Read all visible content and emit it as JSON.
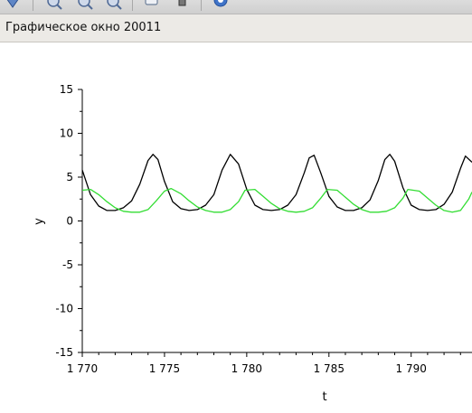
{
  "toolbar": {
    "buttons": [
      "pointer-icon",
      "zoom-in-icon",
      "zoom-out-icon",
      "rotate-icon",
      "datatip-icon",
      "edit-icon",
      "help-icon"
    ]
  },
  "window": {
    "title": "Графическое окно 20011"
  },
  "chart_data": {
    "type": "line",
    "title": "",
    "xlabel": "t",
    "ylabel": "y",
    "xlim": [
      1770,
      1793.7
    ],
    "ylim": [
      -15,
      15
    ],
    "x_ticks": [
      1770,
      1775,
      1780,
      1785,
      1790
    ],
    "x_tick_labels": [
      "1 770",
      "1 775",
      "1 780",
      "1 785",
      "1 790"
    ],
    "y_ticks": [
      15,
      10,
      5,
      0,
      -5,
      -10,
      -15
    ],
    "y_tick_labels": [
      "15",
      "10",
      "5",
      "0",
      "-5",
      "-10",
      "-15"
    ],
    "grid": false,
    "legend": "none",
    "series": [
      {
        "color": "#000000",
        "x": [
          1770.0,
          1770.5,
          1771.0,
          1771.5,
          1772.0,
          1772.5,
          1773.0,
          1773.5,
          1774.0,
          1774.3,
          1774.6,
          1775.0,
          1775.5,
          1776.0,
          1776.5,
          1777.0,
          1777.5,
          1778.0,
          1778.5,
          1779.0,
          1779.5,
          1780.0,
          1780.5,
          1781.0,
          1781.5,
          1782.0,
          1782.5,
          1783.0,
          1783.5,
          1783.8,
          1784.1,
          1784.5,
          1785.0,
          1785.5,
          1786.0,
          1786.5,
          1787.0,
          1787.5,
          1788.0,
          1788.4,
          1788.7,
          1789.0,
          1789.5,
          1790.0,
          1790.5,
          1791.0,
          1791.5,
          1792.0,
          1792.5,
          1793.0,
          1793.3,
          1793.7
        ],
        "y": [
          5.8,
          3.0,
          1.7,
          1.2,
          1.2,
          1.5,
          2.3,
          4.2,
          6.9,
          7.6,
          7.0,
          4.5,
          2.2,
          1.4,
          1.2,
          1.3,
          1.8,
          3.0,
          5.8,
          7.6,
          6.5,
          3.6,
          1.8,
          1.3,
          1.2,
          1.3,
          1.8,
          3.0,
          5.5,
          7.2,
          7.5,
          5.5,
          2.8,
          1.6,
          1.2,
          1.2,
          1.5,
          2.4,
          4.6,
          7.0,
          7.6,
          6.8,
          3.8,
          1.8,
          1.3,
          1.2,
          1.3,
          1.9,
          3.3,
          6.0,
          7.4,
          6.7
        ]
      },
      {
        "color": "#33dd33",
        "x": [
          1770.0,
          1770.5,
          1771.0,
          1771.5,
          1772.0,
          1772.5,
          1773.0,
          1773.5,
          1774.0,
          1774.5,
          1775.0,
          1775.4,
          1776.0,
          1776.5,
          1777.0,
          1777.5,
          1778.0,
          1778.5,
          1779.0,
          1779.5,
          1779.9,
          1780.5,
          1781.0,
          1781.5,
          1782.0,
          1782.5,
          1783.0,
          1783.5,
          1784.0,
          1784.5,
          1784.9,
          1785.5,
          1786.0,
          1786.5,
          1787.0,
          1787.5,
          1788.0,
          1788.5,
          1789.0,
          1789.5,
          1789.8,
          1790.5,
          1791.0,
          1791.5,
          1792.0,
          1792.5,
          1793.0,
          1793.5,
          1793.7
        ],
        "y": [
          3.5,
          3.6,
          3.0,
          2.2,
          1.5,
          1.1,
          1.0,
          1.0,
          1.3,
          2.3,
          3.4,
          3.7,
          3.1,
          2.3,
          1.6,
          1.2,
          1.0,
          1.0,
          1.3,
          2.2,
          3.5,
          3.6,
          2.8,
          2.0,
          1.4,
          1.1,
          1.0,
          1.1,
          1.5,
          2.6,
          3.6,
          3.5,
          2.7,
          1.9,
          1.3,
          1.0,
          1.0,
          1.1,
          1.5,
          2.6,
          3.6,
          3.4,
          2.6,
          1.8,
          1.2,
          1.0,
          1.2,
          2.5,
          3.3
        ]
      }
    ]
  }
}
